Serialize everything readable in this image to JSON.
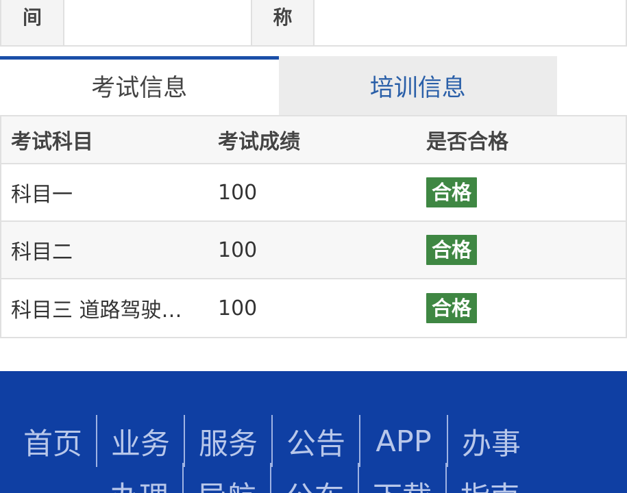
{
  "info": {
    "label1": "间",
    "label2": "称"
  },
  "tabs": [
    {
      "label": "考试信息",
      "active": true
    },
    {
      "label": "培训信息",
      "active": false
    }
  ],
  "exam": {
    "headers": [
      "考试科目",
      "考试成绩",
      "是否合格"
    ],
    "rows": [
      {
        "subject": "科目一",
        "score": "100",
        "result": "合格"
      },
      {
        "subject": "科目二",
        "score": "100",
        "result": "合格"
      },
      {
        "subject": "科目三 道路驾驶…",
        "score": "100",
        "result": "合格"
      }
    ]
  },
  "footer": {
    "nav_row1": [
      "首页",
      "业务",
      "服务",
      "公告",
      "APP",
      "办事"
    ],
    "nav_row2": [
      "办理",
      "导航",
      "公布",
      "下载",
      "指南"
    ]
  },
  "colors": {
    "tab_active_bar": "#1a4fa8",
    "pass_badge": "#3f8743",
    "footer_bg": "#0f3fa3"
  }
}
